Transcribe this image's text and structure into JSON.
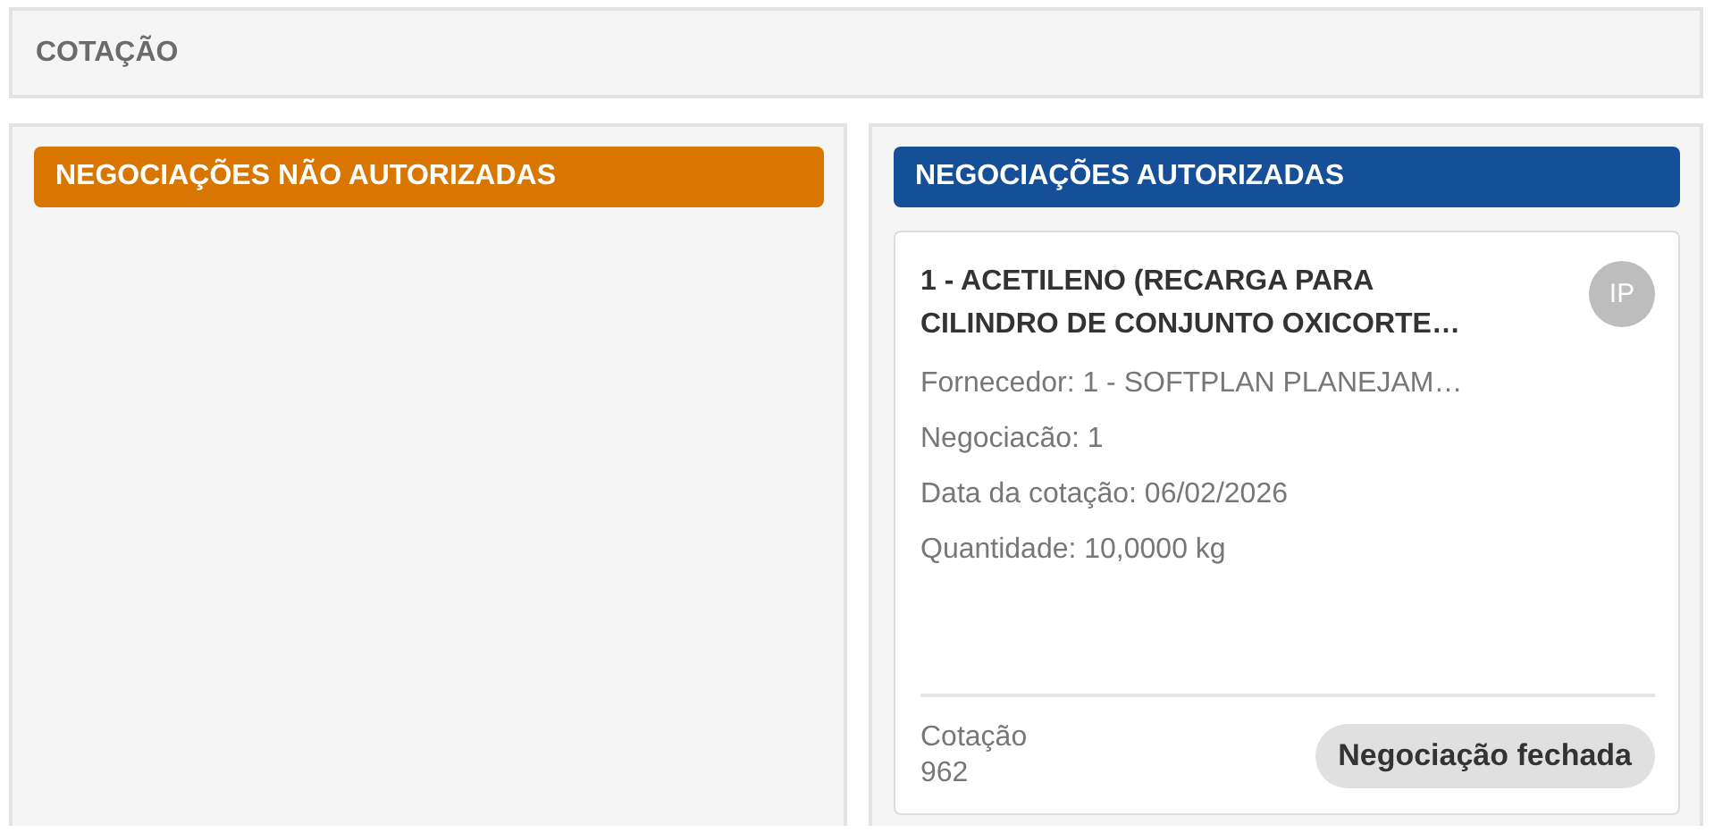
{
  "page_title": "COTAÇÃO",
  "columns": [
    {
      "title": "NEGOCIAÇÕES NÃO AUTORIZADAS",
      "color": "#d87600"
    },
    {
      "title": "NEGOCIAÇÕES AUTORIZADAS",
      "color": "#154f97",
      "cards": [
        {
          "title_lines": [
            "1 - ACETILENO (RECARGA PARA",
            "CILINDRO DE CONJUNTO OXICORTE…"
          ],
          "avatar": "IP",
          "details": [
            "Fornecedor: 1 - SOFTPLAN PLANEJAM…",
            "Negociacão: 1",
            "Data da cotação: 06/02/2026",
            "Quantidade: 10,0000 kg"
          ],
          "footer_label": "Cotação",
          "footer_value": "962",
          "status": "Negociação fechada"
        }
      ]
    }
  ]
}
